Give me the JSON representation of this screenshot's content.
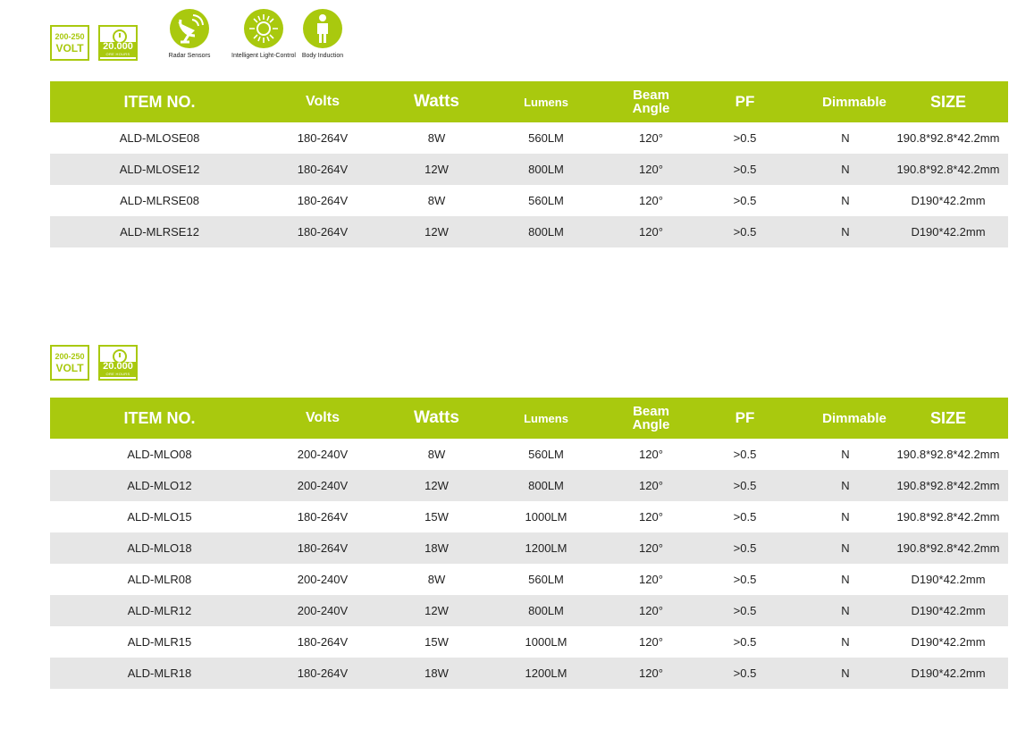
{
  "badges": {
    "volt_range": "200-250",
    "volt_label": "VOLT",
    "hours_value": "20.000",
    "hours_label": "ORE HOURS"
  },
  "features": [
    {
      "label": "Radar Sensors",
      "icon": "radar-sensor-icon"
    },
    {
      "label": "Intelligent Light-Control",
      "icon": "sun-light-icon"
    },
    {
      "label": "Body Induction",
      "icon": "person-icon"
    }
  ],
  "colors": {
    "accent": "#a9c90e",
    "row_alt": "#e6e6e6"
  },
  "headers": {
    "item": "ITEM NO.",
    "volts": "Volts",
    "watts": "Watts",
    "lumens": "Lumens",
    "beam_1": "Beam",
    "beam_2": "Angle",
    "pf": "PF",
    "dimmable": "Dimmable",
    "size": "SIZE"
  },
  "table1": {
    "rows": [
      [
        "ALD-MLOSE08",
        "180-264V",
        "8W",
        "560LM",
        "120°",
        ">0.5",
        "N",
        "190.8*92.8*42.2mm"
      ],
      [
        "ALD-MLOSE12",
        "180-264V",
        "12W",
        "800LM",
        "120°",
        ">0.5",
        "N",
        "190.8*92.8*42.2mm"
      ],
      [
        "ALD-MLRSE08",
        "180-264V",
        "8W",
        "560LM",
        "120°",
        ">0.5",
        "N",
        "D190*42.2mm"
      ],
      [
        "ALD-MLRSE12",
        "180-264V",
        "12W",
        "800LM",
        "120°",
        ">0.5",
        "N",
        "D190*42.2mm"
      ]
    ]
  },
  "table2": {
    "rows": [
      [
        "ALD-MLO08",
        "200-240V",
        "8W",
        "560LM",
        "120°",
        ">0.5",
        "N",
        "190.8*92.8*42.2mm"
      ],
      [
        "ALD-MLO12",
        "200-240V",
        "12W",
        "800LM",
        "120°",
        ">0.5",
        "N",
        "190.8*92.8*42.2mm"
      ],
      [
        "ALD-MLO15",
        "180-264V",
        "15W",
        "1000LM",
        "120°",
        ">0.5",
        "N",
        "190.8*92.8*42.2mm"
      ],
      [
        "ALD-MLO18",
        "180-264V",
        "18W",
        "1200LM",
        "120°",
        ">0.5",
        "N",
        "190.8*92.8*42.2mm"
      ],
      [
        "ALD-MLR08",
        "200-240V",
        "8W",
        "560LM",
        "120°",
        ">0.5",
        "N",
        "D190*42.2mm"
      ],
      [
        "ALD-MLR12",
        "200-240V",
        "12W",
        "800LM",
        "120°",
        ">0.5",
        "N",
        "D190*42.2mm"
      ],
      [
        "ALD-MLR15",
        "180-264V",
        "15W",
        "1000LM",
        "120°",
        ">0.5",
        "N",
        "D190*42.2mm"
      ],
      [
        "ALD-MLR18",
        "180-264V",
        "18W",
        "1200LM",
        "120°",
        ">0.5",
        "N",
        "D190*42.2mm"
      ]
    ]
  }
}
